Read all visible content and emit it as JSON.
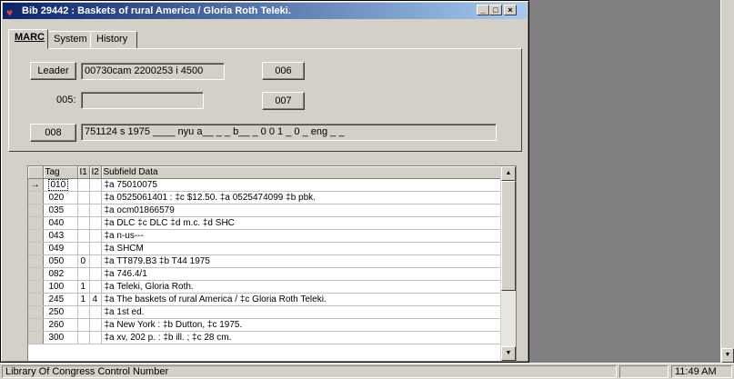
{
  "window": {
    "title": "Bib 29442 : Baskets of rural America / Gloria Roth Teleki.",
    "controls": {
      "minimize": "_",
      "maximize": "□",
      "close": "×"
    }
  },
  "tabs": [
    {
      "label": "MARC",
      "active": true
    },
    {
      "label": "System",
      "active": false
    },
    {
      "label": "History",
      "active": false
    }
  ],
  "fixed_fields": {
    "leader_button": "Leader",
    "leader_value": "00730cam 2200253 i 4500",
    "btn_006": "006",
    "label_005": "005:",
    "value_005": "",
    "btn_007": "007",
    "btn_008": "008",
    "value_008": "751124 s 1975 ____ nyu a__ _ _ b__ _ 0 0 1 _ 0 _ eng _ _"
  },
  "grid": {
    "columns": [
      "Tag",
      "I1",
      "I2",
      "Subfield Data"
    ],
    "rows": [
      {
        "tag": "010",
        "i1": "",
        "i2": "",
        "data": "‡a   75010075",
        "current": true
      },
      {
        "tag": "020",
        "i1": "",
        "i2": "",
        "data": "‡a 0525061401 : ‡c $12.50. ‡a 0525474099 ‡b pbk."
      },
      {
        "tag": "035",
        "i1": "",
        "i2": "",
        "data": "‡a ocm01866579"
      },
      {
        "tag": "040",
        "i1": "",
        "i2": "",
        "data": "‡a DLC ‡c DLC ‡d m.c. ‡d SHC"
      },
      {
        "tag": "043",
        "i1": "",
        "i2": "",
        "data": "‡a n-us---"
      },
      {
        "tag": "049",
        "i1": "",
        "i2": "",
        "data": "‡a SHCM"
      },
      {
        "tag": "050",
        "i1": "0",
        "i2": "",
        "data": "‡a TT879.B3 ‡b T44 1975"
      },
      {
        "tag": "082",
        "i1": "",
        "i2": "",
        "data": "‡a 746.4/1"
      },
      {
        "tag": "100",
        "i1": "1",
        "i2": "",
        "data": "‡a Teleki, Gloria Roth."
      },
      {
        "tag": "245",
        "i1": "1",
        "i2": "4",
        "data": "‡a The baskets of rural America / ‡c Gloria Roth Teleki."
      },
      {
        "tag": "250",
        "i1": "",
        "i2": "",
        "data": "‡a 1st ed."
      },
      {
        "tag": "260",
        "i1": "",
        "i2": "",
        "data": "‡a New York : ‡b Dutton, ‡c 1975."
      },
      {
        "tag": "300",
        "i1": "",
        "i2": "",
        "data": "‡a xv, 202 p. : ‡b ill. ; ‡c 28 cm."
      }
    ],
    "current_row_marker": "→"
  },
  "statusbar": {
    "message": "Library Of Congress Control Number",
    "panel2": "",
    "time": "11:49 AM"
  },
  "colors": {
    "title_gradient_start": "#0a246a",
    "title_gradient_end": "#a6caf0",
    "face": "#d4d0c8",
    "desktop": "#808080"
  }
}
